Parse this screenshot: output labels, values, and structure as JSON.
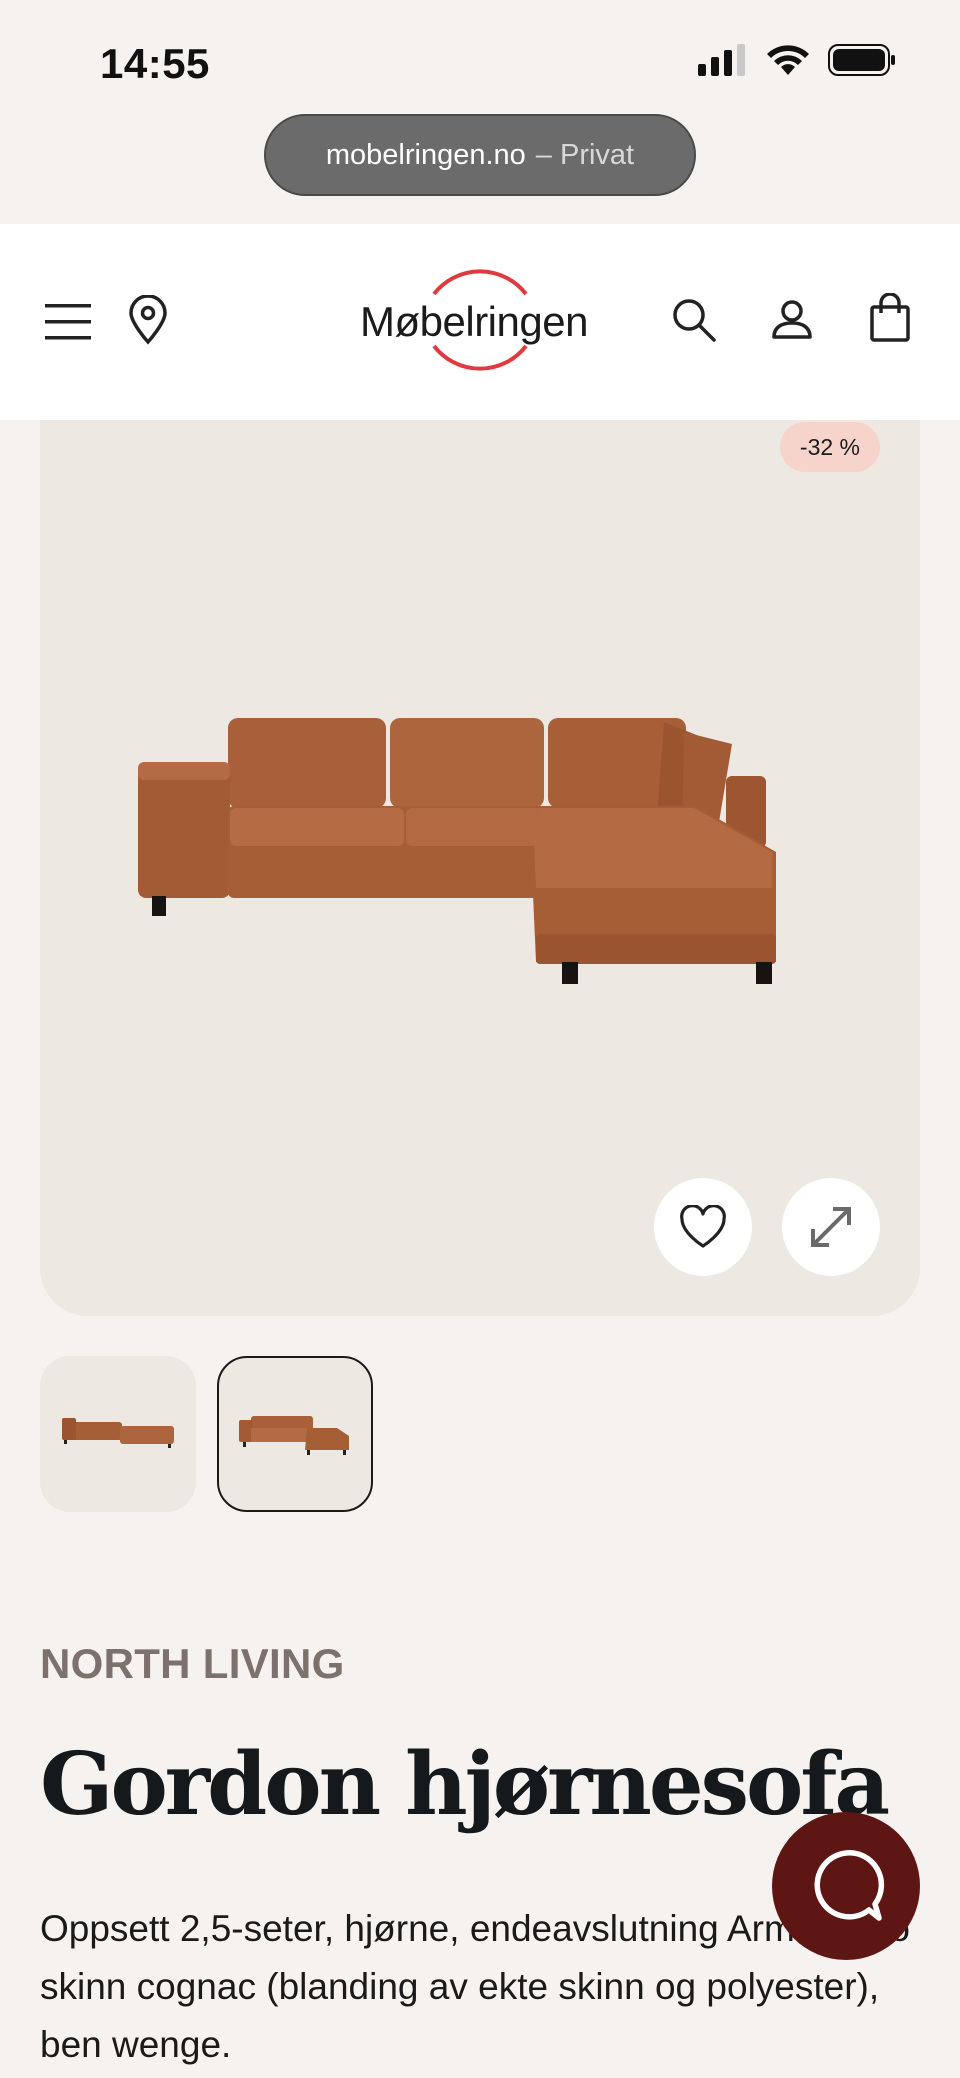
{
  "status_bar": {
    "time": "14:55"
  },
  "browser": {
    "domain": "mobelringen.no",
    "private_label": "– Privat"
  },
  "header": {
    "logo_text": "Møbelringen",
    "brand_color": "#e03a3e"
  },
  "product_image": {
    "discount_badge": "-32 %",
    "favorite_icon": "heart-icon",
    "expand_icon": "expand-icon"
  },
  "thumbnails": [
    {
      "name": "sofa-thumbnail-1",
      "selected": false
    },
    {
      "name": "sofa-thumbnail-2",
      "selected": true
    }
  ],
  "product": {
    "brand": "NORTH LIVING",
    "title": "Gordon hjørnesofa",
    "description": "Oppsett 2,5-seter, hjørne, endeavslutning Arm 1. Eco skinn cognac (blanding av ekte skinn og polyester), ben wenge."
  },
  "chat": {
    "icon": "chat-icon",
    "color": "#5e1614"
  },
  "colors": {
    "background": "#f5f2ef",
    "image_bg": "#ede8e2",
    "badge_bg": "#f6d3cb",
    "brand_text": "#7d716e"
  }
}
